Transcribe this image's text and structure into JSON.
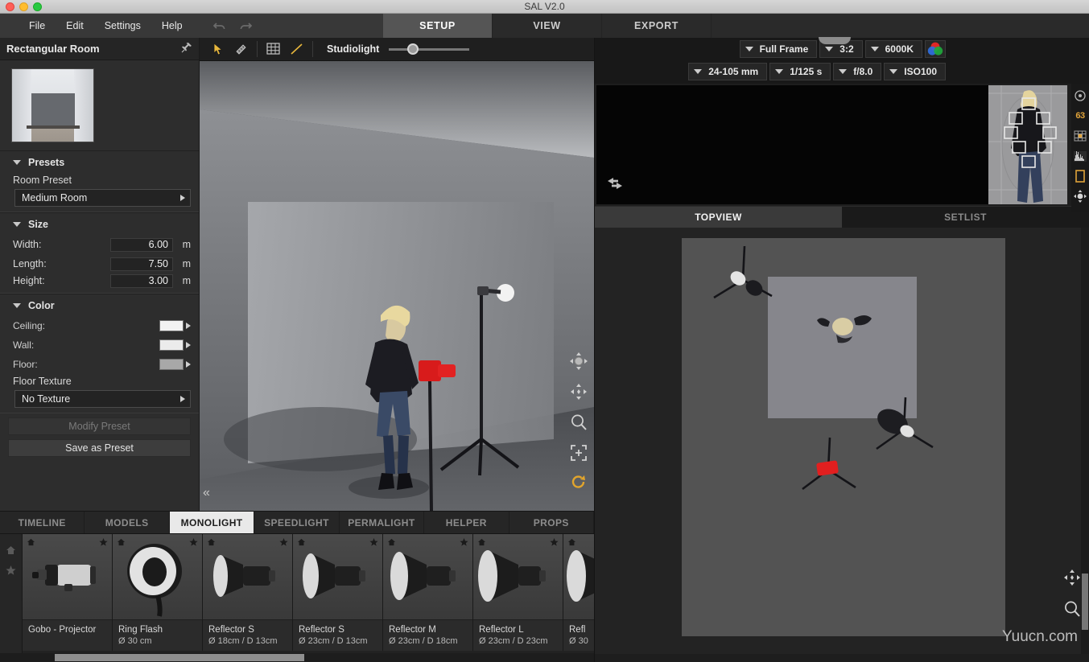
{
  "window": {
    "title": "SAL V2.0",
    "traffic_lights": [
      "close",
      "minimize",
      "zoom"
    ]
  },
  "menu": {
    "items": [
      "File",
      "Edit",
      "Settings",
      "Help"
    ],
    "undo_label": "undo",
    "redo_label": "redo"
  },
  "top_tabs": [
    {
      "label": "SETUP",
      "active": true
    },
    {
      "label": "VIEW",
      "active": false
    },
    {
      "label": "EXPORT",
      "active": false
    }
  ],
  "sidebar": {
    "title": "Rectangular Room",
    "pin_icon": "pin-icon",
    "presets": {
      "section_label": "Presets",
      "field_label": "Room Preset",
      "value": "Medium Room"
    },
    "size": {
      "section_label": "Size",
      "fields": [
        {
          "label": "Width:",
          "value": "6.00",
          "unit": "m"
        },
        {
          "label": "Length:",
          "value": "7.50",
          "unit": "m"
        },
        {
          "label": "Height:",
          "value": "3.00",
          "unit": "m"
        }
      ]
    },
    "color": {
      "section_label": "Color",
      "swatches": [
        {
          "label": "Ceiling:",
          "color": "#f2f2f2"
        },
        {
          "label": "Wall:",
          "color": "#ebebeb"
        },
        {
          "label": "Floor:",
          "color": "#a8a8a8"
        }
      ],
      "texture_label": "Floor Texture",
      "texture_value": "No Texture"
    },
    "buttons": {
      "modify": "Modify Preset",
      "save": "Save as Preset"
    }
  },
  "viewport": {
    "tools": [
      "select-arrow-icon",
      "measure-icon",
      "grid-icon",
      "line-icon"
    ],
    "studiolight_label": "Studiolight",
    "studiolight_value": 28,
    "nav_icons": [
      "orbit-icon",
      "pan-icon",
      "zoom-icon",
      "fit-icon",
      "reset-icon"
    ],
    "collapse_icon": "collapse-left-icon"
  },
  "library": {
    "tabs": [
      {
        "label": "TIMELINE",
        "active": false
      },
      {
        "label": "MODELS",
        "active": false
      },
      {
        "label": "MONOLIGHT",
        "active": true
      },
      {
        "label": "SPEEDLIGHT",
        "active": false
      },
      {
        "label": "PERMALIGHT",
        "active": false
      },
      {
        "label": "HELPER",
        "active": false
      },
      {
        "label": "PROPS",
        "active": false
      }
    ],
    "rail_icons": [
      "home-icon",
      "star-icon"
    ],
    "items": [
      {
        "name": "Gobo - Projector",
        "size": "",
        "icon": "projector-icon"
      },
      {
        "name": "Ring Flash",
        "size": "Ø 30 cm",
        "icon": "ringflash-icon"
      },
      {
        "name": "Reflector S",
        "size": "Ø 18cm / D 13cm",
        "icon": "reflector-icon"
      },
      {
        "name": "Reflector S",
        "size": "Ø 23cm / D 13cm",
        "icon": "reflector-icon"
      },
      {
        "name": "Reflector M",
        "size": "Ø 23cm / D 18cm",
        "icon": "reflector-icon"
      },
      {
        "name": "Reflector L",
        "size": "Ø 23cm / D 23cm",
        "icon": "reflector-icon"
      },
      {
        "name": "Refl",
        "size": "Ø 30",
        "icon": "reflector-icon"
      }
    ]
  },
  "camera": {
    "row1": [
      {
        "name": "sensor",
        "value": "Full Frame"
      },
      {
        "name": "aspect-ratio",
        "value": "3:2"
      },
      {
        "name": "white-balance",
        "value": "6000K"
      }
    ],
    "row2": [
      {
        "name": "lens",
        "value": "24-105 mm"
      },
      {
        "name": "shutter",
        "value": "1/125 s"
      },
      {
        "name": "aperture",
        "value": "f/8.0"
      },
      {
        "name": "iso",
        "value": "ISO100"
      }
    ],
    "color_wheel_icon": "color-wheel-icon"
  },
  "preview": {
    "swap_icon": "swap-arrows-icon",
    "rail": [
      {
        "name": "circle-icon",
        "label": ""
      },
      {
        "name": "focus-count",
        "label": "63"
      },
      {
        "name": "grid-icon",
        "label": ""
      },
      {
        "name": "histogram-icon",
        "label": ""
      },
      {
        "name": "crop-frame-icon",
        "label": ""
      },
      {
        "name": "navigate-icon",
        "label": ""
      }
    ]
  },
  "view_tabs": [
    {
      "label": "TOPVIEW",
      "active": true
    },
    {
      "label": "SETLIST",
      "active": false
    }
  ],
  "topview": {
    "tools": [
      "pan-icon",
      "zoom-icon"
    ],
    "watermark": "Yuucn.com",
    "lights": [
      {
        "name": "monolight-top-left",
        "color": "#d9d9d9"
      },
      {
        "name": "monolight-right",
        "color": "#2b2b2b"
      },
      {
        "name": "monolight-bottom",
        "color": "#e02020"
      }
    ]
  },
  "colors": {
    "accent_orange": "#e0a33a",
    "panel_bg": "#2d2d2d",
    "tab_active": "#555555"
  }
}
